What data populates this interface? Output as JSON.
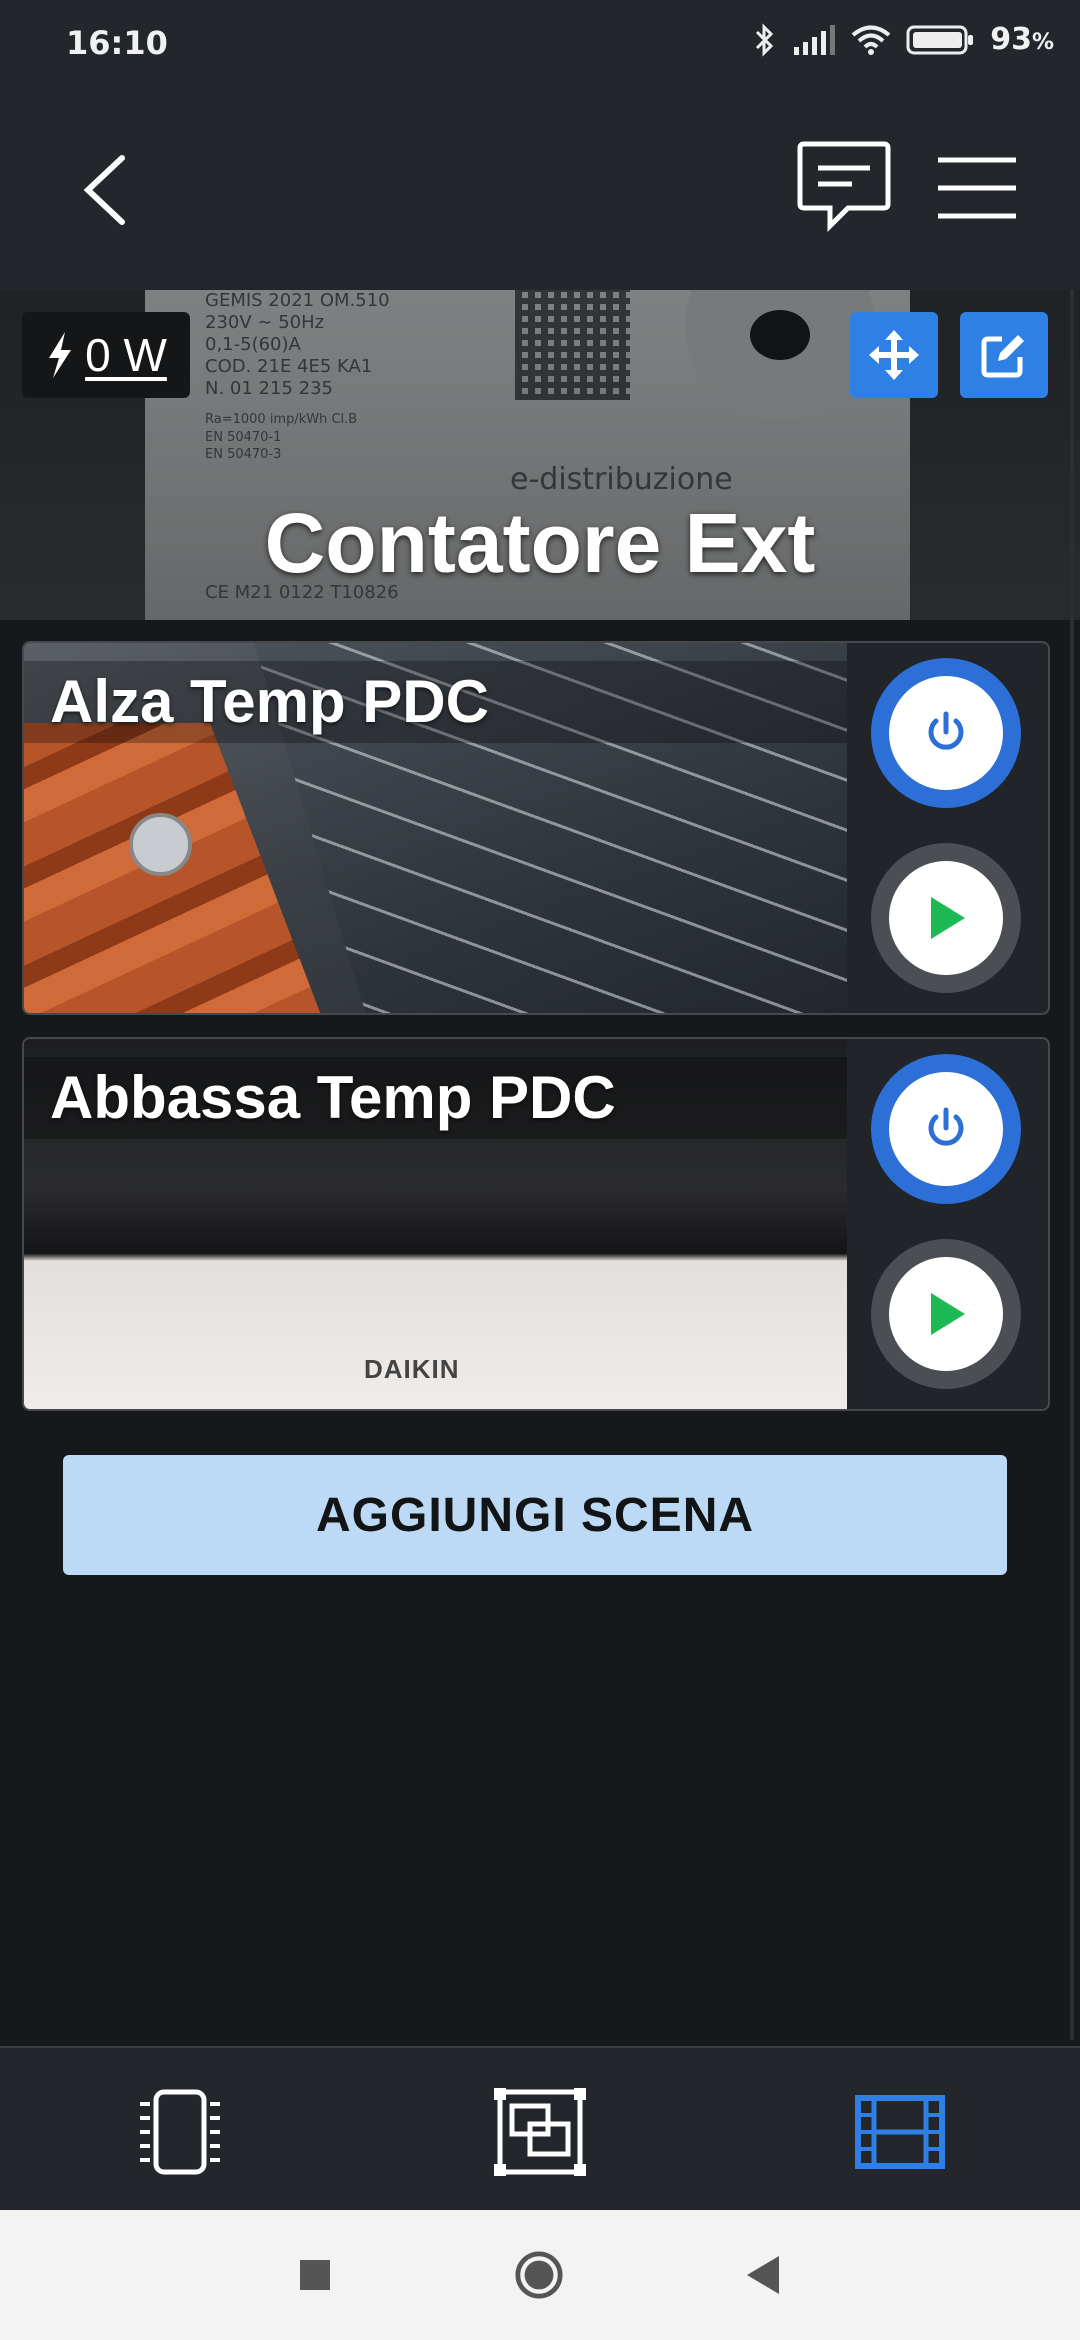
{
  "status_bar": {
    "time": "16:10",
    "battery_percent": "93",
    "battery_unit": "%",
    "icons": [
      "bluetooth-icon",
      "signal-icon",
      "wifi-icon",
      "battery-icon"
    ]
  },
  "app_bar": {
    "back_icon": "chevron-left-icon",
    "chat_icon": "chat-icon",
    "menu_icon": "hamburger-menu-icon"
  },
  "device": {
    "name": "Contatore Ext",
    "power_value": "0 W",
    "photo_text": {
      "line1": "GEMIS    2021    OM.510",
      "line2": "230V ∼ 50Hz",
      "line3": "0,1-5(60)A",
      "line4": "COD. 21E 4E5 KA1",
      "line5": "N. 01 215 235",
      "line6": "Ra=1000 imp/kWh Cl.B",
      "line7": "EN 50470-1",
      "line8": "EN 50470-3",
      "brand": "e-distribuzione",
      "bottom": "CE  M21  0122  T10826"
    }
  },
  "scenes": [
    {
      "title": "Alza Temp PDC"
    },
    {
      "title": "Abbassa Temp PDC",
      "image_label": "DAIKIN"
    }
  ],
  "add_scene_label": "AGGIUNGI SCENA",
  "bottom_nav": {
    "items": [
      {
        "name": "devices",
        "icon": "device-chip-icon",
        "active": false
      },
      {
        "name": "rooms",
        "icon": "rooms-icon",
        "active": false
      },
      {
        "name": "scenes",
        "icon": "film-icon",
        "active": true
      }
    ]
  },
  "colors": {
    "accent": "#2f80e4",
    "background": "#17181b",
    "bar": "#23272c",
    "button_light": "#bcdaf6",
    "play_green": "#1db954"
  }
}
